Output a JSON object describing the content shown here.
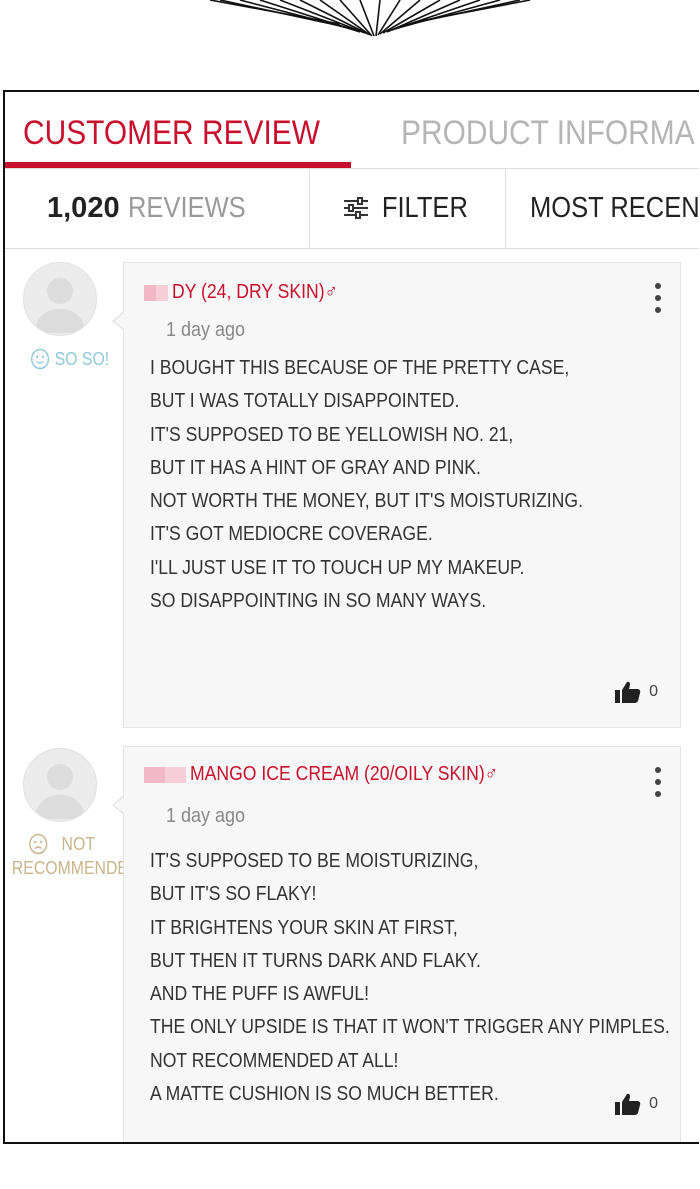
{
  "tabs": {
    "active": "CUSTOMER REVIEW",
    "inactive": "PRODUCT INFORMA"
  },
  "stats": {
    "count": "1,020",
    "count_label": "REVIEWS",
    "filter_label": "FILTER",
    "sort_label": "MOST RECENT"
  },
  "colors": {
    "accent": "#c8102e",
    "soso": "#8fc9d9",
    "notrec": "#c8b48a"
  },
  "reviews": [
    {
      "rating": "SO SO!",
      "rating_icon": "neutral-face-icon",
      "name": "DY (24, DRY SKIN)♂",
      "time": "1 day ago",
      "lines": [
        "I BOUGHT THIS BECAUSE OF THE PRETTY CASE,",
        "BUT I WAS TOTALLY DISAPPOINTED.",
        "IT'S SUPPOSED TO BE YELLOWISH NO. 21,",
        "BUT IT HAS A HINT OF GRAY AND PINK.",
        "NOT WORTH THE MONEY, BUT IT'S MOISTURIZING.",
        "IT'S GOT MEDIOCRE COVERAGE.",
        "I'LL JUST USE IT TO TOUCH UP MY MAKEUP.",
        "SO DISAPPOINTING IN SO MANY WAYS."
      ],
      "likes": "0"
    },
    {
      "rating_line1": "NOT",
      "rating_line2": "RECOMMENDED!",
      "rating_icon": "sad-face-icon",
      "name": "MANGO ICE CREAM (20/OILY SKIN)♂",
      "time": "1 day ago",
      "lines": [
        "IT'S SUPPOSED TO BE MOISTURIZING,",
        "BUT IT'S SO FLAKY!",
        "IT BRIGHTENS YOUR SKIN AT FIRST,",
        "BUT THEN IT TURNS DARK AND FLAKY.",
        "AND THE PUFF IS AWFUL!",
        "THE ONLY UPSIDE IS THAT IT WON'T TRIGGER ANY PIMPLES.",
        "NOT RECOMMENDED AT ALL!",
        "A MATTE CUSHION IS SO MUCH BETTER."
      ],
      "likes": "0"
    }
  ]
}
